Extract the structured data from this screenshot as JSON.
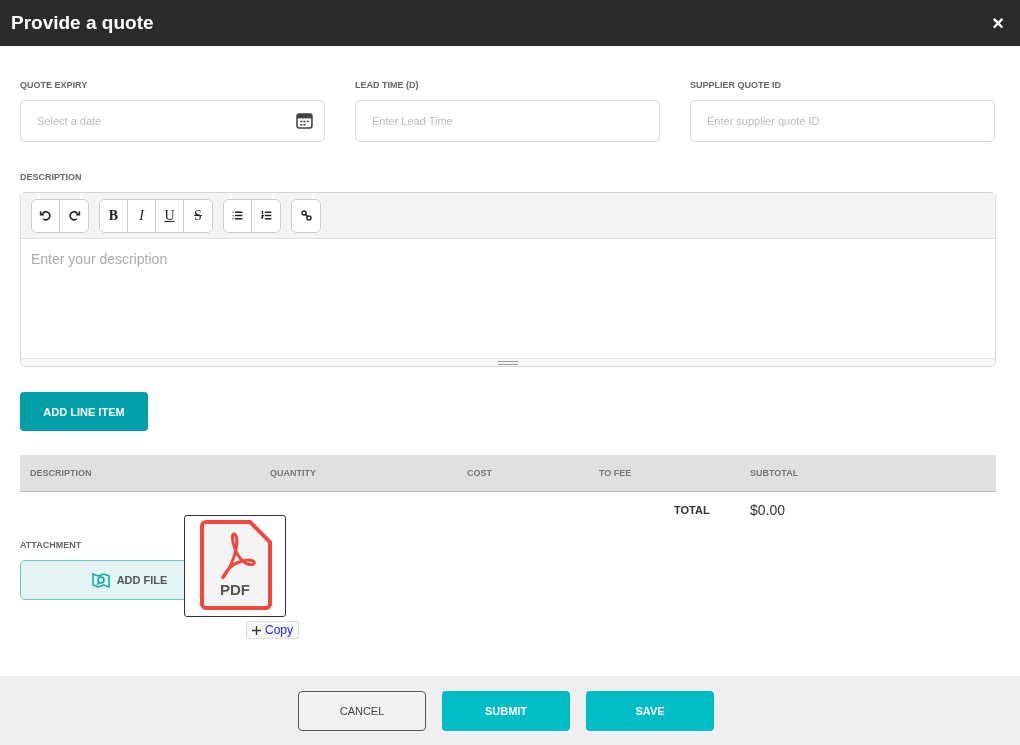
{
  "window": {
    "title": "Provide a quote",
    "close": "×"
  },
  "fields": [
    {
      "label": "QUOTE EXPIRY",
      "placeholder": "Select a date",
      "kind": "date"
    },
    {
      "label": "LEAD TIME (D)",
      "placeholder": "Enter Lead Time",
      "kind": "text"
    },
    {
      "label": "SUPPLIER QUOTE ID",
      "placeholder": "Enter supplier quote ID",
      "kind": "text"
    }
  ],
  "description": {
    "label": "DESCRIPTION",
    "placeholder": "Enter your description",
    "toolbar": [
      [
        {
          "kind": "undo"
        },
        {
          "kind": "redo"
        }
      ],
      [
        {
          "kind": "bold",
          "label": "B"
        },
        {
          "kind": "italic",
          "label": "I"
        },
        {
          "kind": "underline",
          "label": "U"
        },
        {
          "kind": "strike",
          "label": "S"
        }
      ],
      [
        {
          "kind": "bullets"
        },
        {
          "kind": "numbers"
        }
      ],
      [
        {
          "kind": "link"
        }
      ]
    ]
  },
  "add_line_item": "ADD LINE ITEM",
  "table": {
    "columns": [
      "DESCRIPTION",
      "QUANTITY",
      "COST",
      "TO FEE",
      "SUBTOTAL"
    ],
    "total_label": "TOTAL",
    "total": "$0.00"
  },
  "attachment": {
    "label": "ATTACHMENT",
    "button": "ADD FILE"
  },
  "drag_preview": {
    "file_label": "PDF",
    "badge": "Copy"
  },
  "buttons": [
    {
      "label": "CANCEL",
      "kind": "secondary"
    },
    {
      "label": "SUBMIT",
      "kind": "primary"
    },
    {
      "label": "SAVE",
      "kind": "primary"
    }
  ]
}
